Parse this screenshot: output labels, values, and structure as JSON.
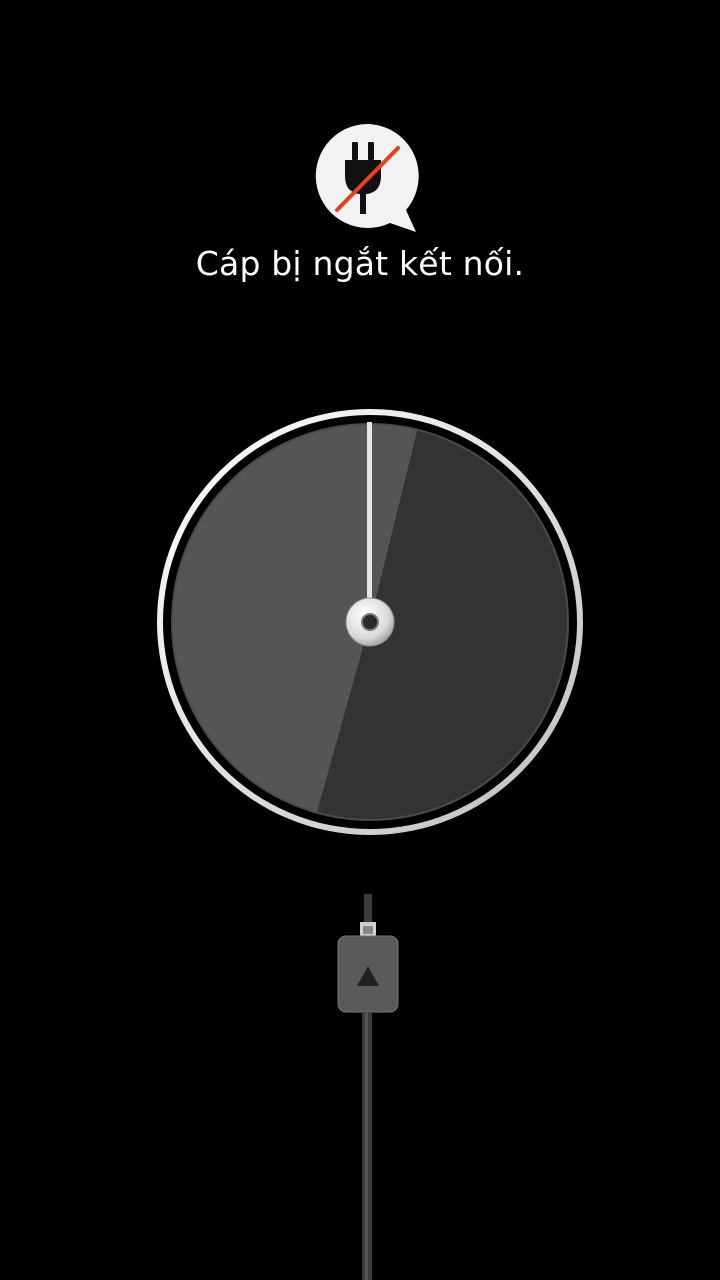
{
  "status": {
    "message": "Cáp bị ngắt kết nối.",
    "icon": "unplugged-icon"
  },
  "dial": {
    "progress_percent": 0,
    "hand_icon": "dial-hand"
  },
  "cable": {
    "icon": "usb-connector-icon"
  },
  "colors": {
    "background": "#000000",
    "text": "#ffffff",
    "strike": "#e8401c",
    "dial_face_dark": "#333333",
    "dial_face_light": "#555555"
  }
}
